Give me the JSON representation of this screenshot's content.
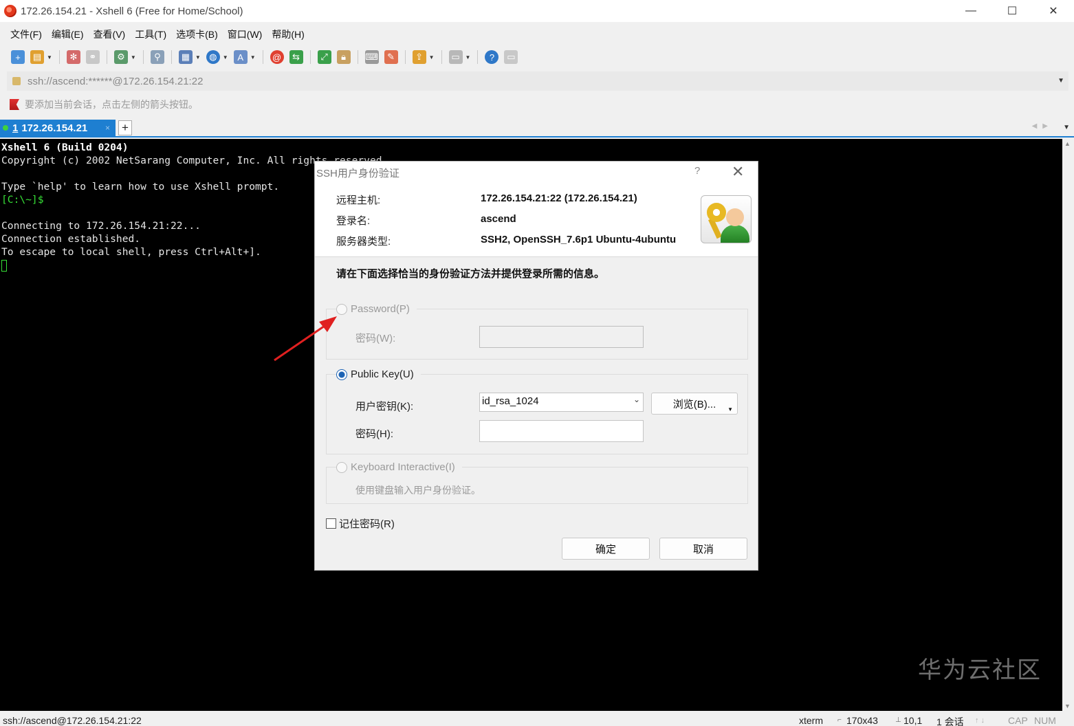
{
  "window": {
    "title": "172.26.154.21 - Xshell 6 (Free for Home/School)",
    "controls": [
      "—",
      "☐",
      "✕"
    ]
  },
  "menu": [
    "文件(F)",
    "编辑(E)",
    "查看(V)",
    "工具(T)",
    "选项卡(B)",
    "窗口(W)",
    "帮助(H)"
  ],
  "address": {
    "value": "ssh://ascend:******@172.26.154.21:22"
  },
  "hint": "要添加当前会话，点击左侧的箭头按钮。",
  "tabs": {
    "active_number": "1",
    "active_label": "172.26.154.21",
    "close": "×",
    "add": "+"
  },
  "terminal": {
    "lines": [
      {
        "text": "Xshell 6 (Build 0204)",
        "style": "bold"
      },
      {
        "text": "Copyright (c) 2002 NetSarang Computer, Inc. All rights reserved.",
        "style": "normal"
      },
      {
        "text": "",
        "style": "normal"
      },
      {
        "text": "Type `help' to learn how to use Xshell prompt.",
        "style": "normal"
      },
      {
        "text": "[C:\\~]$",
        "style": "prompt"
      },
      {
        "text": "",
        "style": "normal"
      },
      {
        "text": "Connecting to 172.26.154.21:22...",
        "style": "normal"
      },
      {
        "text": "Connection established.",
        "style": "normal"
      },
      {
        "text": "To escape to local shell, press Ctrl+Alt+].",
        "style": "normal"
      }
    ]
  },
  "watermark": "华为云社区",
  "status": {
    "connection": "ssh://ascend@172.26.154.21:22",
    "terminal_type": "xterm",
    "size": "170x43",
    "cursor": "10,1",
    "sessions": "1 会话",
    "cap": "CAP",
    "num": "NUM"
  },
  "dialog": {
    "title": "SSH用户身份验证",
    "help": "?",
    "close": "✕",
    "remote_host_label": "远程主机:",
    "remote_host_value": "172.26.154.21:22 (172.26.154.21)",
    "login_label": "登录名:",
    "login_value": "ascend",
    "server_type_label": "服务器类型:",
    "server_type_value": "SSH2, OpenSSH_7.6p1 Ubuntu-4ubuntu",
    "instruction": "请在下面选择恰当的身份验证方法并提供登录所需的信息。",
    "password_option": "Password(P)",
    "password_field_label": "密码(W):",
    "public_key_option": "Public Key(U)",
    "user_key_label": "用户密钥(K):",
    "user_key_value": "id_rsa_1024",
    "browse_button": "浏览(B)...",
    "passphrase_label": "密码(H):",
    "keyboard_option": "Keyboard Interactive(I)",
    "keyboard_desc": "使用键盘输入用户身份验证。",
    "remember_label": "记住密码(R)",
    "ok_button": "确定",
    "cancel_button": "取消",
    "selected_method": "Public Key(U)"
  },
  "colors": {
    "accent": "#1e7fd1",
    "terminal_bg": "#000000",
    "prompt": "#37e037",
    "annotation_arrow": "#e02020"
  }
}
